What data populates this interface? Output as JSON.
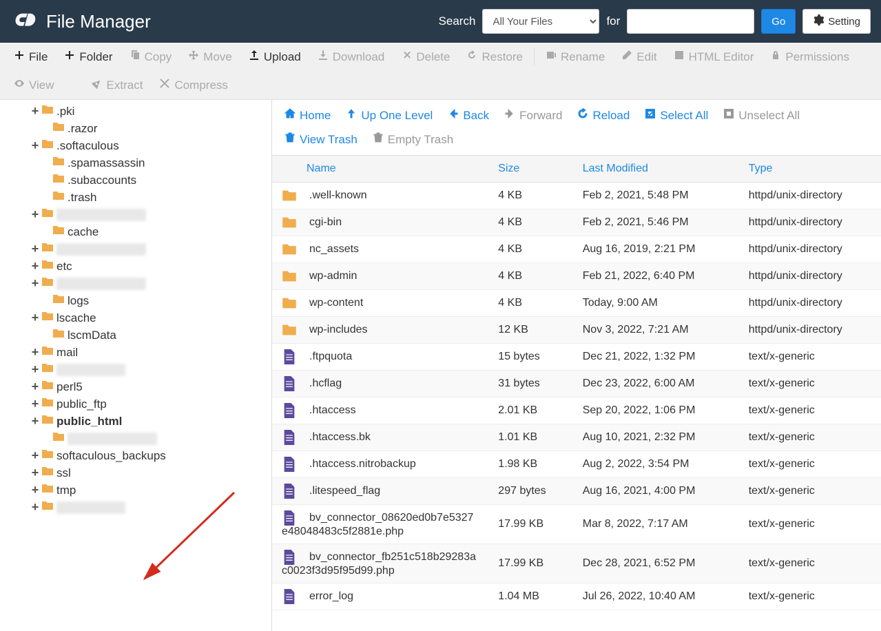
{
  "header": {
    "title": "File Manager",
    "search_label": "Search",
    "for_label": "for",
    "go_label": "Go",
    "settings_label": "Setting",
    "search_options": [
      "All Your Files"
    ]
  },
  "toolbar": [
    {
      "icon": "plus",
      "label": "File",
      "disabled": false
    },
    {
      "icon": "plus",
      "label": "Folder",
      "disabled": false
    },
    {
      "icon": "copy",
      "label": "Copy",
      "disabled": true
    },
    {
      "icon": "move",
      "label": "Move",
      "disabled": true
    },
    {
      "icon": "upload",
      "label": "Upload",
      "disabled": false
    },
    {
      "icon": "download",
      "label": "Download",
      "disabled": true
    },
    {
      "icon": "delete",
      "label": "Delete",
      "disabled": true
    },
    {
      "icon": "restore",
      "label": "Restore",
      "disabled": true
    },
    {
      "sep": true
    },
    {
      "icon": "rename",
      "label": "Rename",
      "disabled": true
    },
    {
      "icon": "edit",
      "label": "Edit",
      "disabled": true
    },
    {
      "icon": "html",
      "label": "HTML Editor",
      "disabled": true
    },
    {
      "icon": "perm",
      "label": "Permissions",
      "disabled": true
    },
    {
      "icon": "view",
      "label": "View",
      "disabled": true
    },
    {
      "spacer": true
    },
    {
      "icon": "extract",
      "label": "Extract",
      "disabled": true
    },
    {
      "icon": "compress",
      "label": "Compress",
      "disabled": true
    }
  ],
  "sidebar": [
    {
      "expand": "+",
      "indent": 44,
      "label": ".pki"
    },
    {
      "expand": "",
      "indent": 60,
      "label": ".razor"
    },
    {
      "expand": "+",
      "indent": 44,
      "label": ".softaculous"
    },
    {
      "expand": "",
      "indent": 60,
      "label": ".spamassassin"
    },
    {
      "expand": "",
      "indent": 60,
      "label": ".subaccounts"
    },
    {
      "expand": "",
      "indent": 60,
      "label": ".trash"
    },
    {
      "expand": "+",
      "indent": 44,
      "blurred": true
    },
    {
      "expand": "",
      "indent": 60,
      "label": "cache"
    },
    {
      "expand": "+",
      "indent": 44,
      "blurred": true
    },
    {
      "expand": "+",
      "indent": 44,
      "label": "etc"
    },
    {
      "expand": "+",
      "indent": 44,
      "blurred": true
    },
    {
      "expand": "",
      "indent": 60,
      "label": "logs"
    },
    {
      "expand": "+",
      "indent": 44,
      "label": "lscache"
    },
    {
      "expand": "",
      "indent": 60,
      "label": "lscmData"
    },
    {
      "expand": "+",
      "indent": 44,
      "label": "mail"
    },
    {
      "expand": "+",
      "indent": 44,
      "blurred": true,
      "sm": true
    },
    {
      "expand": "+",
      "indent": 44,
      "label": "perl5"
    },
    {
      "expand": "+",
      "indent": 44,
      "label": "public_ftp"
    },
    {
      "expand": "+",
      "indent": 44,
      "label": "public_html",
      "bold": true
    },
    {
      "expand": "",
      "indent": 60,
      "blurred": true
    },
    {
      "expand": "+",
      "indent": 44,
      "label": "softaculous_backups"
    },
    {
      "expand": "+",
      "indent": 44,
      "label": "ssl"
    },
    {
      "expand": "+",
      "indent": 44,
      "label": "tmp"
    },
    {
      "expand": "+",
      "indent": 44,
      "blurred": true,
      "sm": true
    }
  ],
  "content_toolbar": [
    {
      "icon": "home",
      "label": "Home",
      "active": true
    },
    {
      "icon": "up",
      "label": "Up One Level",
      "active": true
    },
    {
      "icon": "back",
      "label": "Back",
      "active": true
    },
    {
      "icon": "forward",
      "label": "Forward",
      "active": false
    },
    {
      "icon": "reload",
      "label": "Reload",
      "active": true
    },
    {
      "icon": "selectall",
      "label": "Select All",
      "active": true
    },
    {
      "icon": "unselect",
      "label": "Unselect All",
      "active": false
    },
    {
      "icon": "trash",
      "label": "View Trash",
      "active": true
    },
    {
      "icon": "empty",
      "label": "Empty Trash",
      "active": false
    }
  ],
  "table": {
    "columns": [
      "Name",
      "Size",
      "Last Modified",
      "Type"
    ],
    "rows": [
      {
        "isDir": true,
        "name": ".well-known",
        "size": "4 KB",
        "modified": "Feb 2, 2021, 5:48 PM",
        "type": "httpd/unix-directory"
      },
      {
        "isDir": true,
        "name": "cgi-bin",
        "size": "4 KB",
        "modified": "Feb 2, 2021, 5:46 PM",
        "type": "httpd/unix-directory"
      },
      {
        "isDir": true,
        "name": "nc_assets",
        "size": "4 KB",
        "modified": "Aug 16, 2019, 2:21 PM",
        "type": "httpd/unix-directory"
      },
      {
        "isDir": true,
        "name": "wp-admin",
        "size": "4 KB",
        "modified": "Feb 21, 2022, 6:40 PM",
        "type": "httpd/unix-directory"
      },
      {
        "isDir": true,
        "name": "wp-content",
        "size": "4 KB",
        "modified": "Today, 9:00 AM",
        "type": "httpd/unix-directory"
      },
      {
        "isDir": true,
        "name": "wp-includes",
        "size": "12 KB",
        "modified": "Nov 3, 2022, 7:21 AM",
        "type": "httpd/unix-directory"
      },
      {
        "isDir": false,
        "name": ".ftpquota",
        "size": "15 bytes",
        "modified": "Dec 21, 2022, 1:32 PM",
        "type": "text/x-generic"
      },
      {
        "isDir": false,
        "name": ".hcflag",
        "size": "31 bytes",
        "modified": "Dec 23, 2022, 6:00 AM",
        "type": "text/x-generic"
      },
      {
        "isDir": false,
        "name": ".htaccess",
        "size": "2.01 KB",
        "modified": "Sep 20, 2022, 1:06 PM",
        "type": "text/x-generic"
      },
      {
        "isDir": false,
        "name": ".htaccess.bk",
        "size": "1.01 KB",
        "modified": "Aug 10, 2021, 2:32 PM",
        "type": "text/x-generic"
      },
      {
        "isDir": false,
        "name": ".htaccess.nitrobackup",
        "size": "1.98 KB",
        "modified": "Aug 2, 2022, 3:54 PM",
        "type": "text/x-generic"
      },
      {
        "isDir": false,
        "name": ".litespeed_flag",
        "size": "297 bytes",
        "modified": "Aug 16, 2021, 4:00 PM",
        "type": "text/x-generic"
      },
      {
        "isDir": false,
        "name": "bv_connector_08620ed0b7e5327e48048483c5f2881e.php",
        "size": "17.99 KB",
        "modified": "Mar 8, 2022, 7:17 AM",
        "type": "text/x-generic"
      },
      {
        "isDir": false,
        "name": "bv_connector_fb251c518b29283ac0023f3d95f95d99.php",
        "size": "17.99 KB",
        "modified": "Dec 28, 2021, 6:52 PM",
        "type": "text/x-generic"
      },
      {
        "isDir": false,
        "name": "error_log",
        "size": "1.04 MB",
        "modified": "Jul 26, 2022, 10:40 AM",
        "type": "text/x-generic"
      }
    ]
  }
}
